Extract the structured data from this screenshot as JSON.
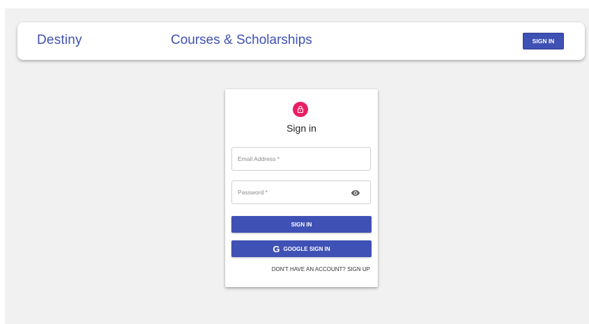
{
  "navbar": {
    "brand": "Destiny",
    "title": "Courses & Scholarships",
    "signin_label": "SIGN IN"
  },
  "card": {
    "icon": "lock-icon",
    "heading": "Sign in",
    "email_label": "Email Address *",
    "password_label": "Password *",
    "password_toggle_icon": "eye-icon",
    "signin_button": "SIGN IN",
    "google_icon": "G",
    "google_button": "GOOGLE SIGN IN",
    "signup_link": "DON'T HAVE AN ACCOUNT? SIGN UP"
  },
  "colors": {
    "primary": "#3f51b5",
    "avatar": "#e91e63",
    "background": "#f1f1f1"
  }
}
